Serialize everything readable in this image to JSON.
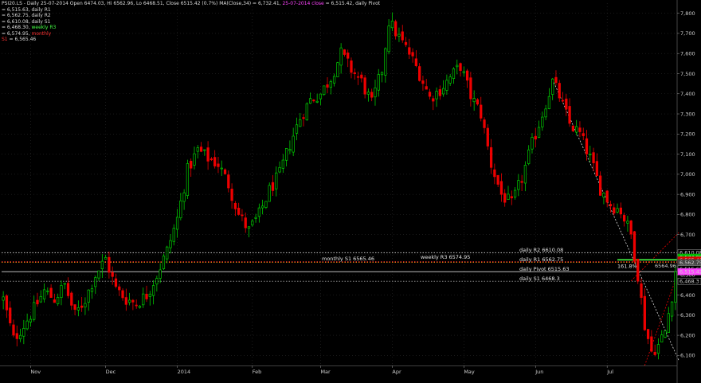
{
  "header": {
    "line1_prefix": "PSI20.LS - Daily 25-07-2014 Open 6474.03, Hi 6562.96, Lo 6468.51, Close 6515.42 (0.7%) MA(Close,34) = 6,732.41, ",
    "line1_close_tag": "25-07-2014 close",
    "line1_suffix": " = 6,515.42, daily Pivot",
    "lines": [
      {
        "text": "= 6,515.63, daily R1",
        "color": "#dcdcdc"
      },
      {
        "text": "= 6,562.75, daily R2",
        "color": "#dcdcdc"
      },
      {
        "text": "= 6,610.08, daily S1",
        "color": "#dcdcdc"
      }
    ],
    "line_weekly_prefix": "= 6,468.30, ",
    "line_weekly_tag": "weekly R3",
    "line_monthly_prefix": "= 6,574.95, ",
    "line_monthly_tag": "monthly",
    "line_s1_tag": "S1",
    "line_s1_value": " = 6,565.46"
  },
  "colors": {
    "background": "#000000",
    "up": "#00cc00",
    "down": "#ee0000",
    "grid": "#2a2a2a",
    "close_tag": "#ff44ff",
    "weekly": "#44ff44",
    "monthly": "#ff3333"
  },
  "chart_data": {
    "type": "candlestick",
    "title": "PSI20.LS - Daily",
    "ylim": [
      6050,
      7850
    ],
    "y_ticks": [
      6100,
      6200,
      6300,
      6400,
      6500,
      6600,
      6700,
      6800,
      6900,
      7000,
      7100,
      7200,
      7300,
      7400,
      7500,
      7600,
      7700,
      7800
    ],
    "y_tick_labels": [
      "6,100",
      "6,200",
      "6,300",
      "6,400",
      "6,500",
      "6,600",
      "6,700",
      "6,800",
      "6,900",
      "7,000",
      "7,100",
      "7,200",
      "7,300",
      "7,400",
      "7,500",
      "7,600",
      "7,700",
      "7,800"
    ],
    "month_labels": [
      {
        "label": "Nov",
        "index": 8
      },
      {
        "label": "Dec",
        "index": 30
      },
      {
        "label": "2014",
        "index": 51
      },
      {
        "label": "Feb",
        "index": 73
      },
      {
        "label": "Mar",
        "index": 93
      },
      {
        "label": "Apr",
        "index": 114
      },
      {
        "label": "May",
        "index": 135
      },
      {
        "label": "Jun",
        "index": 156
      },
      {
        "label": "Jul",
        "index": 177
      }
    ],
    "num_bars": 198,
    "close_path": [
      [
        0,
        6380
      ],
      [
        3,
        6180
      ],
      [
        6,
        6250
      ],
      [
        9,
        6330
      ],
      [
        12,
        6420
      ],
      [
        15,
        6380
      ],
      [
        18,
        6450
      ],
      [
        21,
        6300
      ],
      [
        24,
        6380
      ],
      [
        27,
        6500
      ],
      [
        30,
        6580
      ],
      [
        33,
        6430
      ],
      [
        36,
        6380
      ],
      [
        39,
        6360
      ],
      [
        42,
        6400
      ],
      [
        45,
        6500
      ],
      [
        48,
        6620
      ],
      [
        51,
        6780
      ],
      [
        54,
        7020
      ],
      [
        57,
        7120
      ],
      [
        60,
        7080
      ],
      [
        63,
        7050
      ],
      [
        66,
        6950
      ],
      [
        69,
        6800
      ],
      [
        72,
        6720
      ],
      [
        75,
        6800
      ],
      [
        78,
        6920
      ],
      [
        81,
        7000
      ],
      [
        84,
        7150
      ],
      [
        87,
        7280
      ],
      [
        90,
        7370
      ],
      [
        93,
        7400
      ],
      [
        96,
        7480
      ],
      [
        99,
        7600
      ],
      [
        102,
        7520
      ],
      [
        105,
        7460
      ],
      [
        108,
        7350
      ],
      [
        111,
        7520
      ],
      [
        113,
        7760
      ],
      [
        116,
        7680
      ],
      [
        119,
        7600
      ],
      [
        122,
        7500
      ],
      [
        125,
        7380
      ],
      [
        128,
        7420
      ],
      [
        131,
        7480
      ],
      [
        134,
        7540
      ],
      [
        137,
        7390
      ],
      [
        140,
        7300
      ],
      [
        143,
        7050
      ],
      [
        146,
        6900
      ],
      [
        149,
        6850
      ],
      [
        152,
        6980
      ],
      [
        155,
        7150
      ],
      [
        158,
        7300
      ],
      [
        161,
        7460
      ],
      [
        163,
        7390
      ],
      [
        166,
        7250
      ],
      [
        169,
        7200
      ],
      [
        172,
        7080
      ],
      [
        175,
        6930
      ],
      [
        178,
        6850
      ],
      [
        181,
        6820
      ],
      [
        184,
        6700
      ],
      [
        186,
        6500
      ],
      [
        188,
        6250
      ],
      [
        190,
        6120
      ],
      [
        192,
        6150
      ],
      [
        194,
        6220
      ],
      [
        196,
        6400
      ],
      [
        197,
        6515
      ]
    ],
    "current_price": 6515.42,
    "levels": [
      {
        "name": "daily R2",
        "label": "daily R2 6610.08",
        "value": 6610.08,
        "color": "#c8c8c8",
        "style": "dotted"
      },
      {
        "name": "daily R1",
        "label": "daily R1 6562.75",
        "value": 6562.75,
        "color": "#ffaa00",
        "style": "dotted"
      },
      {
        "name": "daily Pivot",
        "label": "daily Pivot 6515.63",
        "value": 6515.63,
        "color": "#bbbbbb",
        "style": "solid"
      },
      {
        "name": "daily S1",
        "label": "daily S1 6468.3",
        "value": 6468.3,
        "color": "#888888",
        "style": "dotted"
      },
      {
        "name": "weekly R3",
        "label": "weekly R3 6574.95",
        "value": 6574.95,
        "color": "#44ff44",
        "style": "solid"
      },
      {
        "name": "monthly S1",
        "label": "monthly S1 6565.46",
        "value": 6565.46,
        "color": "#ff3333",
        "style": "dotted"
      }
    ],
    "annotations": [
      {
        "text": "161.8%",
        "value": 6555
      }
    ],
    "price_tags": [
      {
        "text": "6,610.08",
        "value": 6610.08,
        "bg": "#000000",
        "fg": "#dddddd",
        "border": "#888888"
      },
      {
        "text": "6,574.95",
        "value": 6588,
        "bg": "#00bb00",
        "fg": "#000000",
        "border": "#00bb00"
      },
      {
        "text": "6,565.46",
        "value": 6574,
        "bg": "#dd0000",
        "fg": "#000000",
        "border": "#dd0000"
      },
      {
        "text": "6,562.75",
        "value": 6561,
        "bg": "#444444",
        "fg": "#dddddd",
        "border": "#444444"
      },
      {
        "text": "6,515.63",
        "value": 6530,
        "bg": "#000000",
        "fg": "#dddddd",
        "border": "#888888"
      },
      {
        "text": "6,515.42",
        "value": 6516,
        "bg": "#ff44ff",
        "fg": "#000000",
        "border": "#ff44ff"
      },
      {
        "text": "6,468.3",
        "value": 6468.3,
        "bg": "#000000",
        "fg": "#dddddd",
        "border": "#888888"
      }
    ],
    "side_tag": {
      "text": "6564.96",
      "value": 6545
    },
    "trend_lines": [
      {
        "color": "#dddddd",
        "from": [
          161,
          7470
        ],
        "to": [
          198,
          6075
        ],
        "style": "dotted"
      },
      {
        "color": "#ee0000",
        "from": [
          188,
          6050
        ],
        "to": [
          198,
          6520
        ],
        "style": "dotted"
      },
      {
        "color": "#ee0000",
        "from": [
          184,
          6470
        ],
        "to": [
          198,
          6710
        ],
        "style": "dotted"
      }
    ],
    "grid": true
  }
}
